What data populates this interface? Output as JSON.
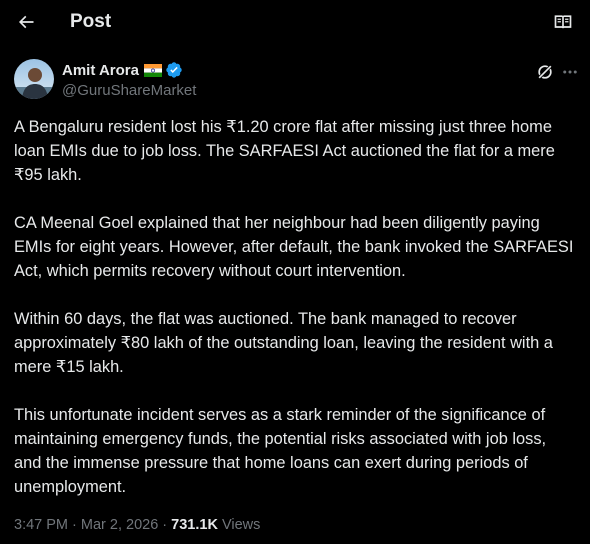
{
  "header": {
    "title": "Post",
    "back_icon": "arrow-left-icon",
    "reader_icon": "reader-mode-icon"
  },
  "author": {
    "display_name": "Amit Arora",
    "flag_icon": "india-flag-icon",
    "verified_icon": "verified-badge-icon",
    "handle": "@GuruShareMarket"
  },
  "actions": {
    "grok_icon": "grok-icon",
    "more_icon": "more-horizontal-icon"
  },
  "tweet": {
    "paragraphs": [
      "A Bengaluru resident lost his ₹1.20 crore flat after missing just three home loan EMIs due to job loss. The SARFAESI Act auctioned the flat for a mere ₹95 lakh.",
      "CA Meenal Goel explained that her neighbour had been diligently paying EMIs for eight years. However, after default, the bank invoked the SARFAESI Act, which permits recovery without court intervention.",
      "Within 60 days, the flat was auctioned. The bank managed to recover approximately ₹80 lakh of the outstanding loan, leaving the resident with a mere ₹15 lakh.",
      "This unfortunate incident serves as a stark reminder of the significance of maintaining emergency funds, the potential risks associated with job loss, and the immense pressure that home loans can exert during periods of unemployment."
    ]
  },
  "meta": {
    "time": "3:47 PM",
    "separator": " · ",
    "date": "Mar 2, 2026",
    "views_count": "731.1K",
    "views_label": " Views"
  },
  "colors": {
    "background": "#000000",
    "text": "#e7e9ea",
    "muted": "#71767b",
    "verified": "#1d9bf0"
  }
}
